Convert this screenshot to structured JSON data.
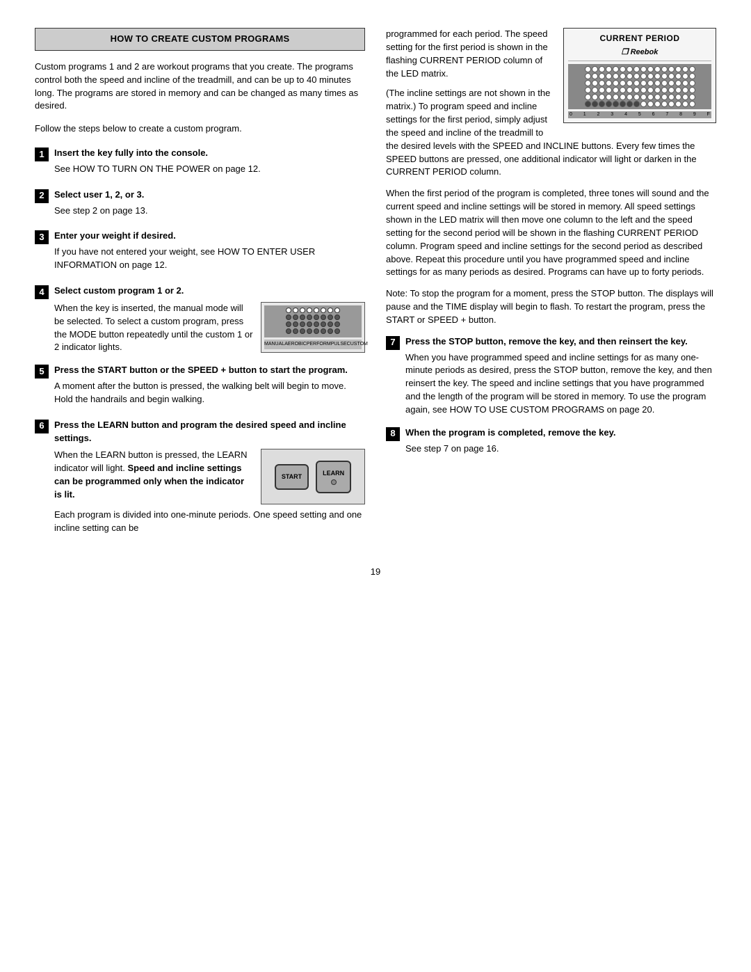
{
  "page": {
    "number": "19"
  },
  "header": {
    "title": "HOW TO CREATE CUSTOM PROGRAMS"
  },
  "left": {
    "intro": "Custom programs 1 and 2 are workout programs that you create. The programs control both the speed and incline of the treadmill, and can be up to 40 minutes long. The programs are stored in memory and can be changed as many times as desired.",
    "follow": "Follow the steps below to create a custom program.",
    "steps": [
      {
        "number": "1",
        "title": "Insert the key fully into the console.",
        "desc": "See HOW TO TURN ON THE POWER on page 12."
      },
      {
        "number": "2",
        "title": "Select user 1, 2, or 3.",
        "desc": "See step 2 on page 13."
      },
      {
        "number": "3",
        "title": "Enter your weight if desired.",
        "desc": "If you have not entered your weight, see HOW TO ENTER USER INFORMATION on page 12."
      },
      {
        "number": "4",
        "title": "Select custom program 1 or 2.",
        "desc": "When the key is inserted, the manual mode will be selected. To select a custom program, press the MODE button repeatedly until the custom 1 or 2 indicator lights."
      },
      {
        "number": "5",
        "title": "Press the START button or the SPEED + button to start the program.",
        "desc": "A moment after the button is pressed, the walking belt will begin to move. Hold the handrails and begin walking."
      },
      {
        "number": "6",
        "title": "Press the LEARN button and program the desired speed and incline settings.",
        "desc_parts": [
          "When the LEARN button is pressed, the LEARN indicator will light. ",
          "Speed and incline settings can be programmed only when the indicator is lit."
        ],
        "desc_end": "Each program is divided into one-minute periods. One speed setting and one incline setting can be"
      }
    ]
  },
  "right": {
    "current_period_label": "CURRENT PERIOD",
    "reebok_logo": "Reebok",
    "intro_parts": [
      "programmed for each period. The speed setting for the first period is shown in the flashing CURRENT PERIOD column of the LED matrix."
    ],
    "incline_note": "(The incline settings are not shown in the matrix.) To program speed and incline settings for the first period, simply adjust the speed and incline of the treadmill to the desired levels with the SPEED and INCLINE buttons. Every few times the SPEED buttons are pressed, one additional indicator will light or darken in the CURRENT PERIOD column.",
    "para2": "When the first period of the program is completed, three tones will sound and the current speed and incline settings will be stored in memory. All speed settings shown in the LED matrix will then move one column to the left and the speed setting for the second period will be shown in the flashing CURRENT PERIOD column. Program speed and incline settings for the second period as described above. Repeat this procedure until you have programmed speed and incline settings for as many periods as desired. Programs can have up to forty periods.",
    "note": "Note: To stop the program for a moment, press the STOP button. The displays will pause and the TIME display will begin to flash. To restart the program, press the START or SPEED + button.",
    "steps": [
      {
        "number": "7",
        "title": "Press the STOP button, remove the key, and then reinsert the key.",
        "desc": "When you have programmed speed and incline settings for as many one-minute periods as desired, press the STOP button, remove the key, and then reinsert the key. The speed and incline settings that you have programmed and the length of the program will be stored in memory. To use the program again, see HOW TO USE CUSTOM PROGRAMS on page 20."
      },
      {
        "number": "8",
        "title": "When the program is completed, remove the key.",
        "desc": "See step 7 on page 16."
      }
    ]
  },
  "buttons": {
    "start_label": "START",
    "learn_label": "LEARN"
  }
}
